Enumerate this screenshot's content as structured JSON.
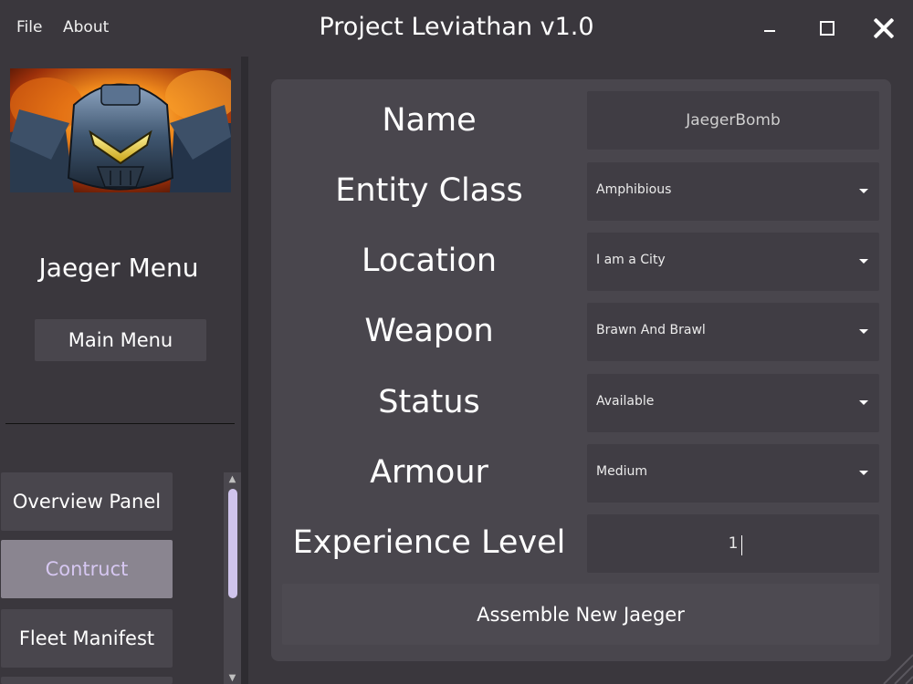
{
  "window": {
    "title": "Project Leviathan v1.0",
    "menu": [
      "File",
      "About"
    ]
  },
  "sidebar": {
    "heading": "Jaeger Menu",
    "main_menu_label": "Main Menu",
    "nav_items": [
      {
        "label": "Overview Panel",
        "active": false
      },
      {
        "label": "Contruct",
        "active": true
      },
      {
        "label": "Fleet Manifest",
        "active": false
      }
    ]
  },
  "form": {
    "fields": [
      {
        "label": "Name",
        "type": "text",
        "value": "JaegerBomb"
      },
      {
        "label": "Entity Class",
        "type": "select",
        "value": "Amphibious"
      },
      {
        "label": "Location",
        "type": "select",
        "value": "I am a City"
      },
      {
        "label": "Weapon",
        "type": "select",
        "value": "Brawn And Brawl"
      },
      {
        "label": "Status",
        "type": "select",
        "value": "Available"
      },
      {
        "label": "Armour",
        "type": "select",
        "value": "Medium"
      },
      {
        "label": "Experience Level",
        "type": "text",
        "value": "1"
      }
    ],
    "submit_label": "Assemble New Jaeger"
  },
  "colors": {
    "background": "#3a373d",
    "panel": "#49464d",
    "field": "#403d44",
    "active_nav": "#8a8590",
    "active_nav_text": "#d6c7f1",
    "scroll_thumb": "#cfc4ec"
  }
}
